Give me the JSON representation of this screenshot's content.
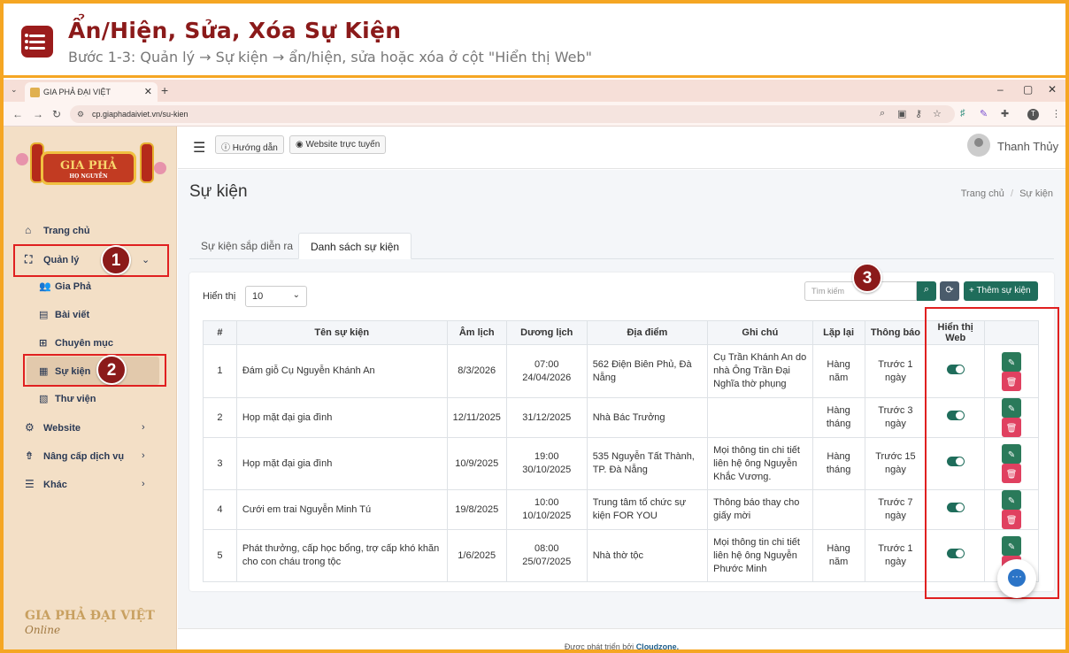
{
  "tutorial": {
    "title": "Ẩn/Hiện, Sửa, Xóa Sự Kiện",
    "subtitle": "Bước 1-3: Quản lý → Sự kiện → ẩn/hiện, sửa hoặc xóa ở cột \"Hiển thị Web\""
  },
  "browser": {
    "tab_title": "GIA PHẢ ĐẠI VIỆT",
    "url": "cp.giaphadaiviet.vn/su-kien"
  },
  "sidebar": {
    "logo_text": "GIA PHẢ",
    "logo_sub": "HỌ NGUYỄN",
    "items": [
      {
        "label": "Trang chủ",
        "icon": "home-icon"
      },
      {
        "label": "Quản lý",
        "icon": "sitemap-icon"
      },
      {
        "label": "Gia Phả",
        "icon": "users-icon"
      },
      {
        "label": "Bài viết",
        "icon": "newspaper-icon"
      },
      {
        "label": "Chuyên mục",
        "icon": "grid-icon"
      },
      {
        "label": "Sự kiện",
        "icon": "calendar-icon"
      },
      {
        "label": "Thư viện",
        "icon": "images-icon"
      },
      {
        "label": "Website",
        "icon": "gear-icon"
      },
      {
        "label": "Nâng cấp dịch vụ",
        "icon": "level-up-icon"
      },
      {
        "label": "Khác",
        "icon": "list-icon"
      }
    ],
    "footer_brand": "GIA PHẢ ĐẠI VIỆT",
    "footer_online": "Online"
  },
  "topbar": {
    "guide_label": "Hướng dẫn",
    "website_label": "Website trực tuyến",
    "user_name": "Thanh Thủy"
  },
  "page": {
    "title": "Sự kiện",
    "breadcrumb_home": "Trang chủ",
    "breadcrumb_sep": "/",
    "breadcrumb_current": "Sự kiện",
    "tabs": [
      "Sự kiện sắp diễn ra",
      "Danh sách sự kiện"
    ]
  },
  "toolbar": {
    "show_label": "Hiển thị",
    "show_value": "10",
    "search_placeholder": "Tìm kiếm",
    "add_label": "Thêm sự kiện"
  },
  "table": {
    "headers": [
      "#",
      "Tên sự kiện",
      "Âm lịch",
      "Dương lịch",
      "Địa điểm",
      "Ghi chú",
      "Lặp lại",
      "Thông báo",
      "Hiển thị Web",
      ""
    ],
    "rows": [
      {
        "no": "1",
        "name": "Đám giỗ Cụ Nguyễn Khánh An",
        "lunar": "8/3/2026",
        "solar_time": "07:00",
        "solar_date": "24/04/2026",
        "place": "562 Điện Biên Phủ, Đà Nẵng",
        "note": "Cụ Trần Khánh An do nhà Ông Trần Đại Nghĩa thờ phụng",
        "repeat": "Hàng năm",
        "notify": "Trước 1 ngày",
        "visible": true
      },
      {
        "no": "2",
        "name": "Họp mặt đại gia đình",
        "lunar": "12/11/2025",
        "solar_time": "",
        "solar_date": "31/12/2025",
        "place": "Nhà Bác Trưởng",
        "note": "",
        "repeat": "Hàng tháng",
        "notify": "Trước 3 ngày",
        "visible": true
      },
      {
        "no": "3",
        "name": "Họp mặt đại gia đình",
        "lunar": "10/9/2025",
        "solar_time": "19:00",
        "solar_date": "30/10/2025",
        "place": "535 Nguyễn Tất Thành, TP. Đà Nẵng",
        "note": "Mọi thông tin chi tiết liên hệ ông Nguyễn Khắc Vương.",
        "repeat": "Hàng tháng",
        "notify": "Trước 15 ngày",
        "visible": true
      },
      {
        "no": "4",
        "name": "Cưới em trai Nguyễn Minh Tú",
        "lunar": "19/8/2025",
        "solar_time": "10:00",
        "solar_date": "10/10/2025",
        "place": "Trung tâm tổ chức sự kiện FOR YOU",
        "note": "Thông báo thay cho giấy mời",
        "repeat": "",
        "notify": "Trước 7 ngày",
        "visible": true
      },
      {
        "no": "5",
        "name": "Phát thưởng, cấp học bổng, trợ cấp khó khăn cho con cháu trong tộc",
        "lunar": "1/6/2025",
        "solar_time": "08:00",
        "solar_date": "25/07/2025",
        "place": "Nhà thờ tộc",
        "note": "Mọi thông tin chi tiết liên hệ ông Nguyễn Phước Minh",
        "repeat": "Hàng năm",
        "notify": "Trước 1 ngày",
        "visible": true
      }
    ]
  },
  "footer": {
    "text": "Được phát triển bởi",
    "brand": "Cloudzone."
  },
  "annotations": {
    "step1": "1",
    "step2": "2",
    "step3": "3"
  },
  "colors": {
    "accent": "#1f6d5b",
    "danger": "#e04060",
    "frame": "#f5a623",
    "highlight": "#e02020",
    "brand": "#8b1a1a"
  }
}
